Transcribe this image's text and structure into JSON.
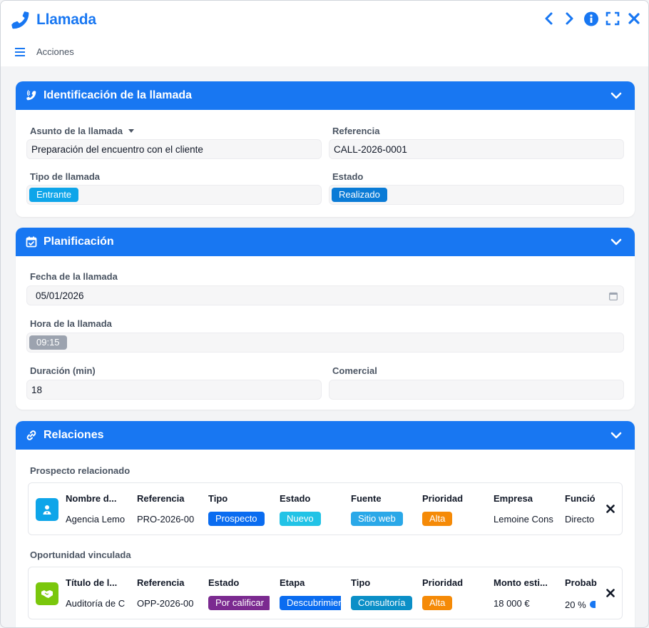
{
  "window": {
    "title": "Llamada",
    "actions_label": "Acciones"
  },
  "colors": {
    "accent": "#1877f2",
    "entrante": "#0ea5e9",
    "realizado": "#0a7bd6",
    "time_badge": "#9ca3af",
    "prospecto": "#0a6cf0",
    "nuevo": "#22c3e6",
    "sitio_web": "#2aa8e8",
    "alta": "#f58a07",
    "por_calificar": "#7b2a90",
    "descubrimiento": "#0a6cf0",
    "consultoria": "#0b8fc7"
  },
  "identificacion": {
    "title": "Identificación de la llamada",
    "asunto_label": "Asunto de la llamada",
    "asunto_value": "Preparación del encuentro con el cliente",
    "referencia_label": "Referencia",
    "referencia_value": "CALL-2026-0001",
    "tipo_label": "Tipo de llamada",
    "tipo_value": "Entrante",
    "estado_label": "Estado",
    "estado_value": "Realizado"
  },
  "planificacion": {
    "title": "Planificación",
    "fecha_label": "Fecha de la llamada",
    "fecha_value": "05/01/2026",
    "hora_label": "Hora de la llamada",
    "hora_value": "09:15",
    "duracion_label": "Duración (min)",
    "duracion_value": "18",
    "comercial_label": "Comercial",
    "comercial_value": ""
  },
  "relaciones": {
    "title": "Relaciones",
    "prospecto": {
      "label": "Prospecto relacionado",
      "headers": [
        "Nombre d...",
        "Referencia",
        "Tipo",
        "Estado",
        "Fuente",
        "Prioridad",
        "Empresa",
        "Funció"
      ],
      "values": {
        "nombre": "Agencia Lemo",
        "referencia": "PRO-2026-00",
        "tipo": "Prospecto",
        "estado": "Nuevo",
        "fuente": "Sitio web",
        "prioridad": "Alta",
        "empresa": "Lemoine Cons",
        "funcion": "Directo"
      }
    },
    "oportunidad": {
      "label": "Oportunidad vinculada",
      "headers": [
        "Título de l...",
        "Referencia",
        "Estado",
        "Etapa",
        "Tipo",
        "Prioridad",
        "Monto esti...",
        "Probab"
      ],
      "values": {
        "titulo": "Auditoría de C",
        "referencia": "OPP-2026-00",
        "estado": "Por calificar",
        "etapa": "Descubrimiento",
        "tipo": "Consultoría",
        "prioridad": "Alta",
        "monto": "18 000 €",
        "probabilidad": "20 %"
      }
    }
  }
}
